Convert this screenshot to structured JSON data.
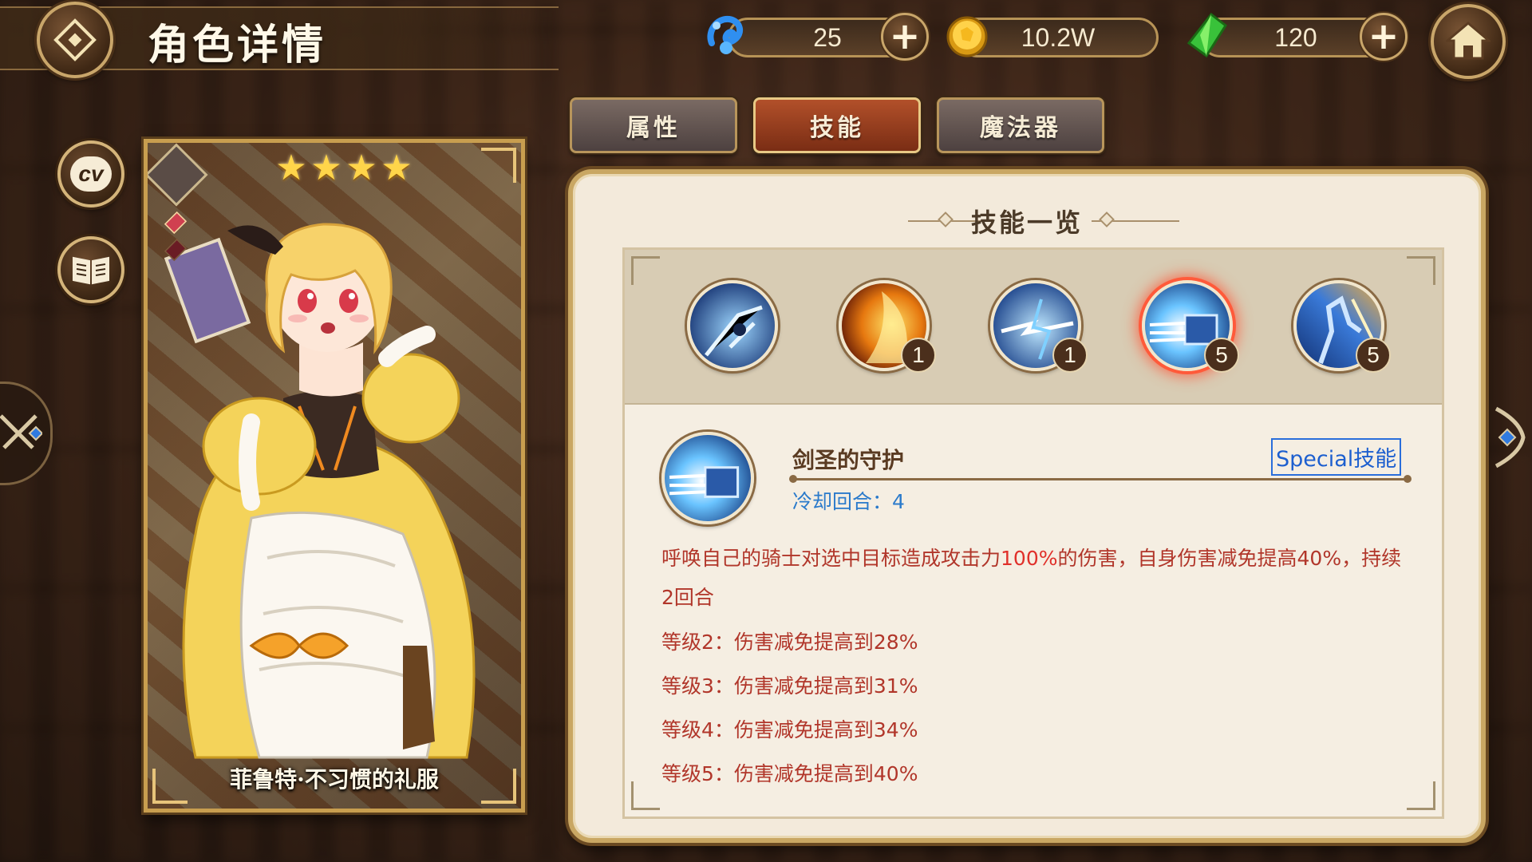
{
  "header": {
    "title": "角色详情"
  },
  "currencies": [
    {
      "name": "blue-crystal",
      "icon": "blue-spirit-icon",
      "value": "25",
      "has_plus": true
    },
    {
      "name": "gold",
      "icon": "gold-coin-icon",
      "value": "10.2W",
      "has_plus": false
    },
    {
      "name": "green-gem",
      "icon": "green-crystal-icon",
      "value": "120",
      "has_plus": true
    }
  ],
  "plus_label": "+",
  "side_buttons": {
    "cv_label": "cv"
  },
  "character": {
    "name": "菲鲁特·不习惯的礼服",
    "stars": [
      "★",
      "★",
      "★",
      "★"
    ]
  },
  "tabs": [
    {
      "label": "属性",
      "active": false
    },
    {
      "label": "技能",
      "active": true
    },
    {
      "label": "魔法器",
      "active": false
    }
  ],
  "skills_panel": {
    "heading": "技能一览",
    "slots": [
      {
        "level": "",
        "selected": false
      },
      {
        "level": "1",
        "selected": false
      },
      {
        "level": "1",
        "selected": false
      },
      {
        "level": "5",
        "selected": true
      },
      {
        "level": "5",
        "selected": false
      }
    ],
    "detail": {
      "name": "剑圣的守护",
      "type": "Special技能",
      "cooldown": "冷却回合：4",
      "desc_before": "呼唤自己的骑士对选中目标造成攻击力",
      "desc_highlight": "100%",
      "desc_after": "的伤害，自身伤害减免提高40%，持续2回合",
      "levels": [
        "等级2：伤害减免提高到28%",
        "等级3：伤害减免提高到31%",
        "等级4：伤害减免提高到34%",
        "等级5：伤害减免提高到40%"
      ]
    }
  },
  "colors": {
    "accent_gold": "#c9a66a",
    "tab_active": "#b2502a",
    "desc_red": "#b1362a",
    "cooldown_blue": "#2a7acb",
    "special_blue": "#1d5fcf"
  }
}
